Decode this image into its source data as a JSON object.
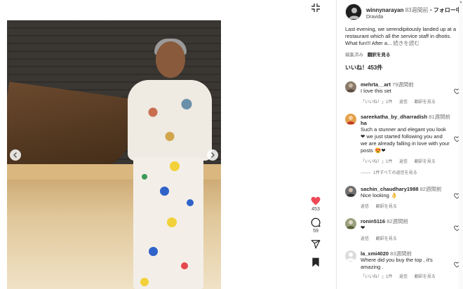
{
  "post": {
    "username": "winnynarayan",
    "time": "83週間前",
    "separator": "•",
    "follow_label": "フォロー中",
    "location": "Dravida",
    "caption": "Last evening, we serendipitously landed up at a restaurant which all the service staff in dhotis. What fun!!! After a...",
    "caption_more": "続きを読む",
    "edited_label": "編集済み",
    "translation_label": "翻訳を見る",
    "likes_label": "いいね！453件"
  },
  "actions": {
    "like_count": "453",
    "comment_count": "59"
  },
  "colors": {
    "heart": "#ed4956",
    "text_primary": "#262626",
    "text_secondary": "#737373"
  },
  "comments": [
    {
      "username": "mehrta__art",
      "time": "79週間前",
      "text": "I love this set",
      "meta": [
        "「いいね！」1件",
        "返信",
        "翻訳を見る"
      ]
    },
    {
      "username": "sareekatha_by_dharradish",
      "username_cont": "ha",
      "time": "81週間前",
      "text": "Such a stunner and elegant you look ❤ we just started following you and we are already falling in love with your posts 😍❤",
      "meta": [
        "「いいね！」1件",
        "返信",
        "翻訳を見る"
      ],
      "replies": "1件すべての返信を見る"
    },
    {
      "username": "sachin_chaudhary1988",
      "time": "82週間前",
      "text": "Nice looking 👌",
      "meta": [
        "返信",
        "翻訳を見る"
      ]
    },
    {
      "username": "ronin5116",
      "time": "82週間前",
      "text": "❤",
      "meta": [
        "返信",
        "翻訳を見る"
      ]
    },
    {
      "username": "la_xmi4020",
      "time": "83週間前",
      "text": "Where did you buy the top , it's amazing .",
      "meta": [
        "「いいね！」1件",
        "返信",
        "翻訳を見る"
      ]
    }
  ],
  "icons": {
    "shrink": "shrink-icon",
    "prev": "chevron-left-icon",
    "next": "chevron-right-icon",
    "like": "heart-icon",
    "comment": "comment-icon",
    "share": "share-icon",
    "save": "bookmark-icon"
  }
}
